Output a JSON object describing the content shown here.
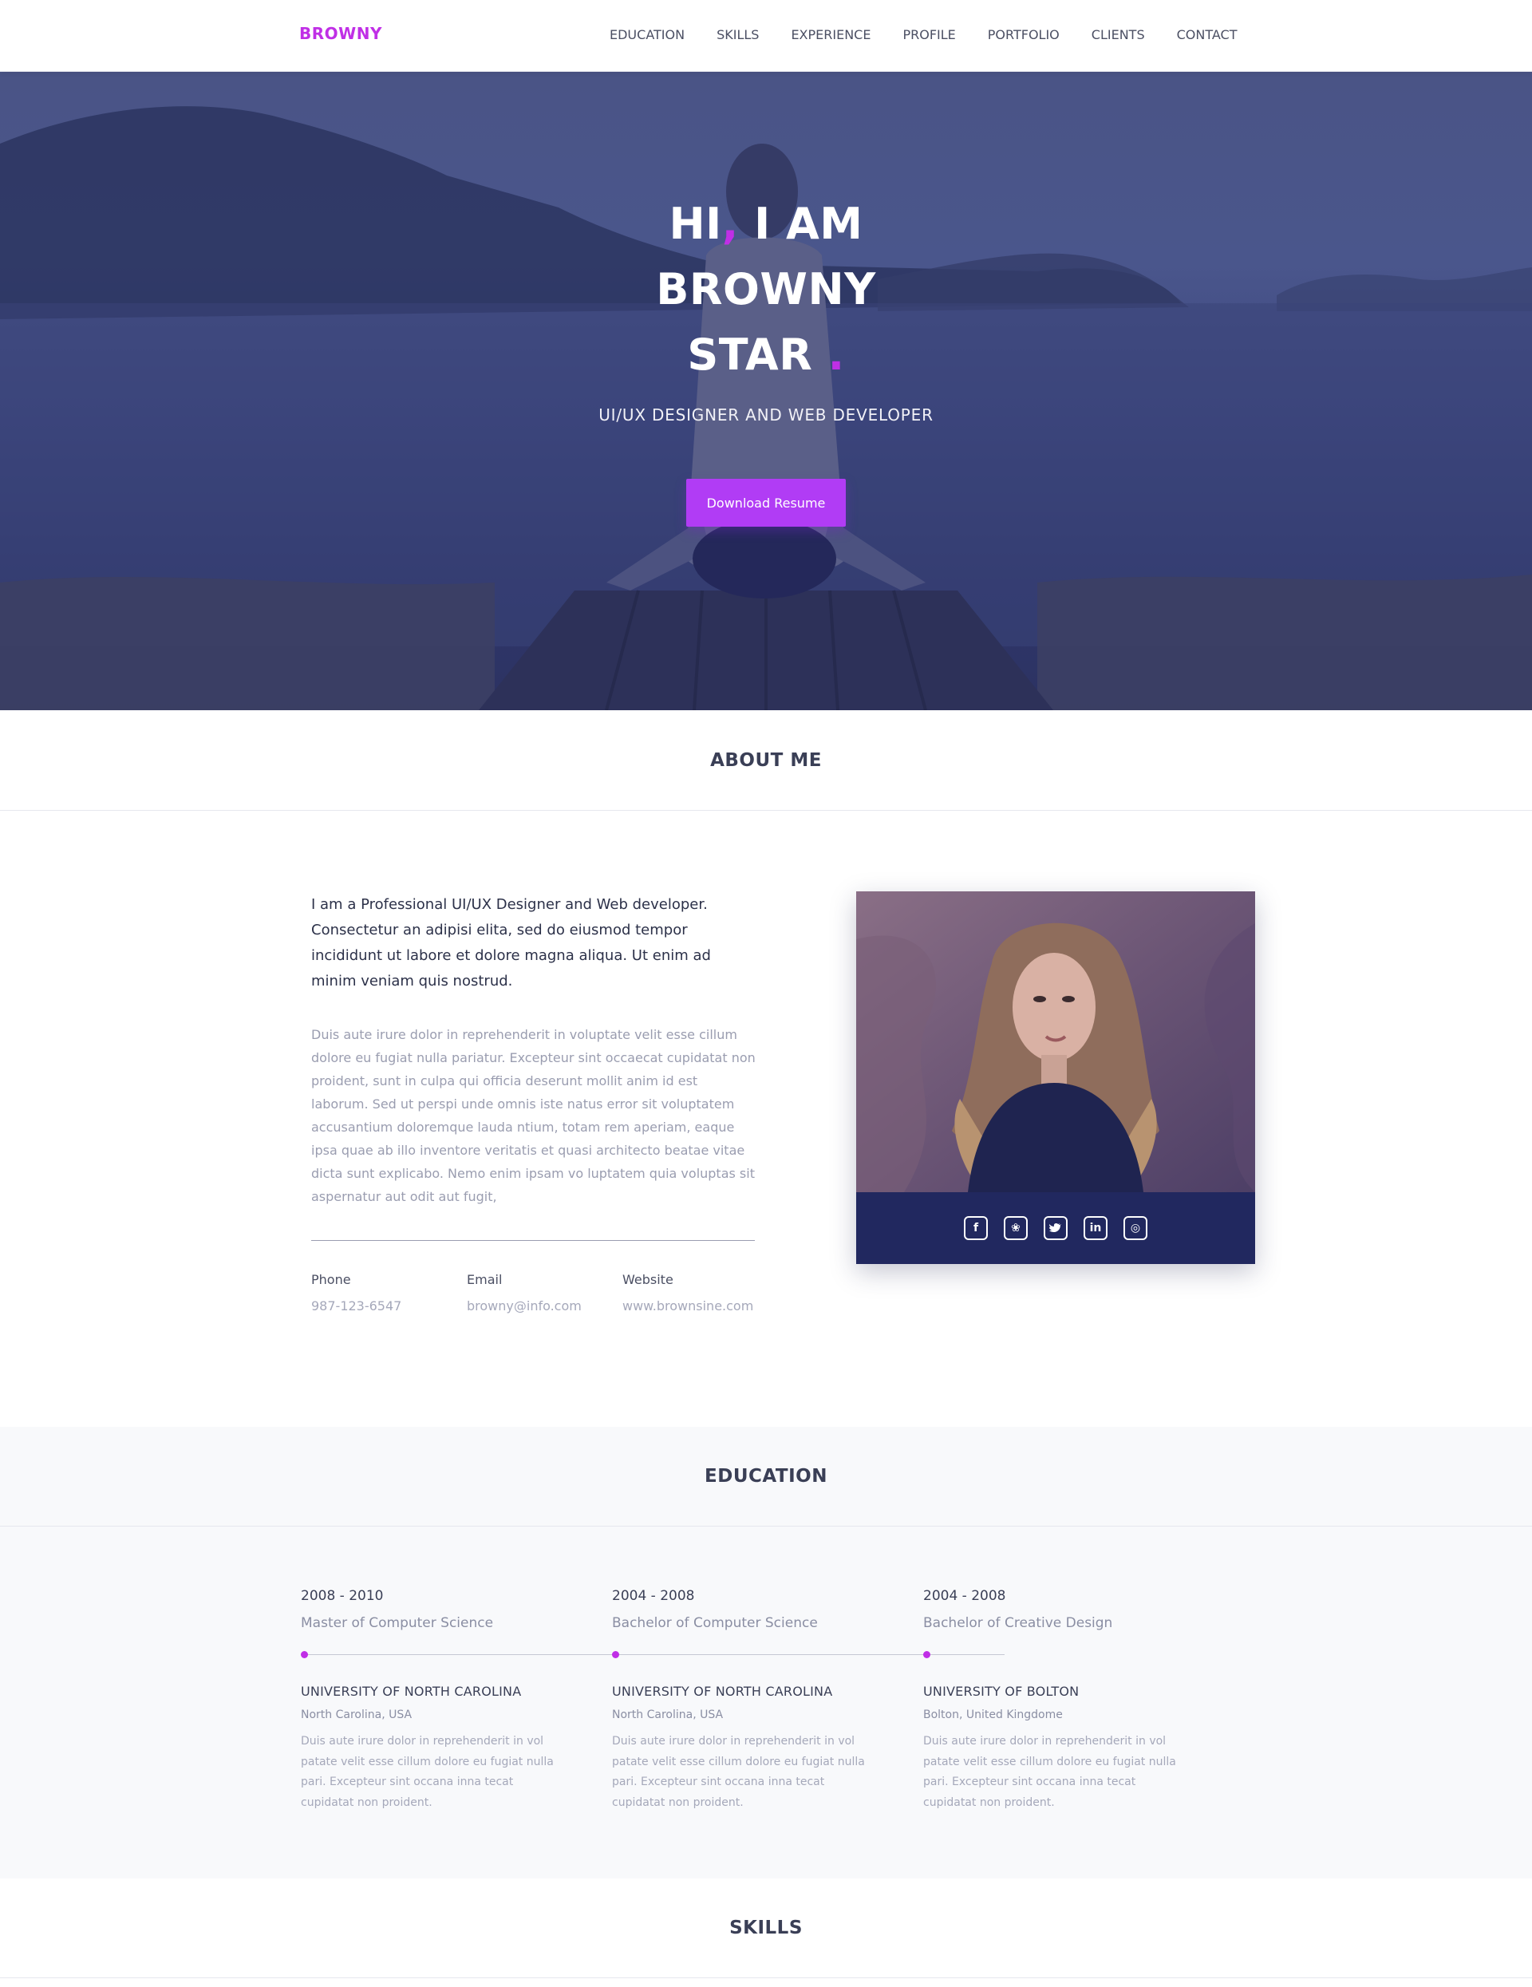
{
  "nav": {
    "brand": "BROWNY",
    "links": [
      "EDUCATION",
      "SKILLS",
      "EXPERIENCE",
      "PROFILE",
      "PORTFOLIO",
      "CLIENTS",
      "CONTACT"
    ]
  },
  "hero": {
    "line1_a": "HI",
    "line1_comma": ",",
    "line1_b": "I AM",
    "line2": "BROWNY",
    "line3": "STAR",
    "line3_dot": ".",
    "subtitle": "UI/UX DESIGNER AND WEB DEVELOPER",
    "button": "Download Resume"
  },
  "about": {
    "title": "ABOUT ME",
    "lead": "I am a Professional UI/UX Designer and Web developer. Consectetur an adipisi elita, sed do eiusmod tempor incididunt ut labore et dolore magna aliqua. Ut enim ad minim veniam quis nostrud.",
    "body": "Duis aute irure dolor in reprehenderit in voluptate velit esse cillum dolore eu fugiat nulla pariatur. Excepteur sint occaecat cupidatat non proident, sunt in culpa qui officia deserunt mollit anim id est laborum. Sed ut perspi unde omnis iste natus error sit voluptatem accusantium doloremque lauda ntium, totam rem aperiam, eaque ipsa quae ab illo inventore veritatis et quasi architecto beatae vitae dicta sunt explicabo. Nemo enim ipsam vo luptatem quia voluptas sit aspernatur aut odit aut fugit,",
    "contacts": [
      {
        "label": "Phone",
        "value": "987-123-6547"
      },
      {
        "label": "Email",
        "value": "browny@info.com"
      },
      {
        "label": "Website",
        "value": "www.brownsine.com"
      }
    ],
    "social": [
      {
        "icon": "facebook-icon",
        "glyph": "f"
      },
      {
        "icon": "dribbble-icon",
        "glyph": "❀"
      },
      {
        "icon": "twitter-icon",
        "glyph": "•"
      },
      {
        "icon": "linkedin-icon",
        "glyph": "in"
      },
      {
        "icon": "instagram-icon",
        "glyph": "◎"
      }
    ]
  },
  "education": {
    "title": "EDUCATION",
    "items": [
      {
        "years": "2008 - 2010",
        "degree": "Master of Computer Science",
        "university": "UNIVERSITY OF NORTH CAROLINA",
        "location": "North Carolina, USA",
        "desc": "Duis aute irure dolor in reprehenderit in vol patate velit esse cillum dolore eu fugiat nulla pari. Excepteur sint occana inna tecat cupidatat non proident."
      },
      {
        "years": "2004 - 2008",
        "degree": "Bachelor of Computer Science",
        "university": "UNIVERSITY OF NORTH CAROLINA",
        "location": "North Carolina, USA",
        "desc": "Duis aute irure dolor in reprehenderit in vol patate velit esse cillum dolore eu fugiat nulla pari. Excepteur sint occana inna tecat cupidatat non proident."
      },
      {
        "years": "2004 - 2008",
        "degree": "Bachelor of Creative Design",
        "university": "UNIVERSITY OF BOLTON",
        "location": "Bolton, United Kingdome",
        "desc": "Duis aute irure dolor in reprehenderit in vol patate velit esse cillum dolore eu fugiat nulla pari. Excepteur sint occana inna tecat cupidatat non proident."
      }
    ]
  },
  "skills": {
    "title": "SKILLS"
  }
}
